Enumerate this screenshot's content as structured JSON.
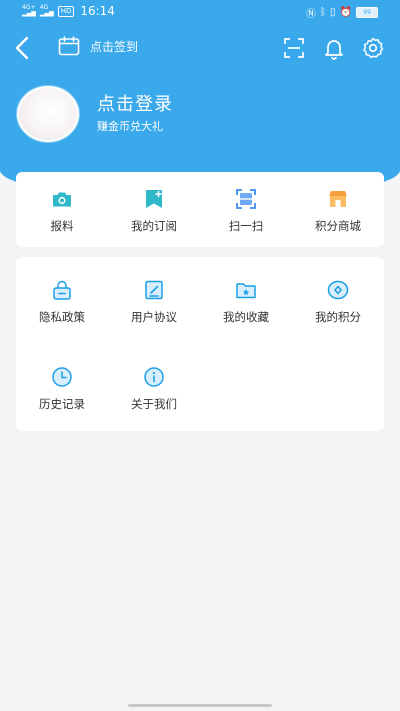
{
  "status_bar": {
    "signal1": "4G+",
    "signal2": "4G",
    "hd": "HD",
    "time": "16:14",
    "battery_text": "99",
    "battery_level": 0.99
  },
  "top_bar": {
    "sign_in_label": "点击签到"
  },
  "profile": {
    "login_label": "点击登录",
    "subtitle": "赚金币兑大礼"
  },
  "quick_menu": [
    {
      "label": "报料",
      "icon": "camera-icon"
    },
    {
      "label": "我的订阅",
      "icon": "bookmark-add-icon"
    },
    {
      "label": "扫一扫",
      "icon": "scan-icon"
    },
    {
      "label": "积分商城",
      "icon": "store-icon"
    }
  ],
  "service_menu": [
    {
      "label": "隐私政策",
      "icon": "lock-icon"
    },
    {
      "label": "用户协议",
      "icon": "edit-icon"
    },
    {
      "label": "我的收藏",
      "icon": "folder-star-icon"
    },
    {
      "label": "我的积分",
      "icon": "points-icon"
    },
    {
      "label": "历史记录",
      "icon": "clock-icon"
    },
    {
      "label": "关于我们",
      "icon": "info-icon"
    }
  ],
  "colors": {
    "header": "#3aa9ec",
    "accent": "#1a9fe6",
    "icon_teal": "#2fb8c8",
    "icon_orange": "#f7a13c",
    "background": "#f4f4f5"
  }
}
